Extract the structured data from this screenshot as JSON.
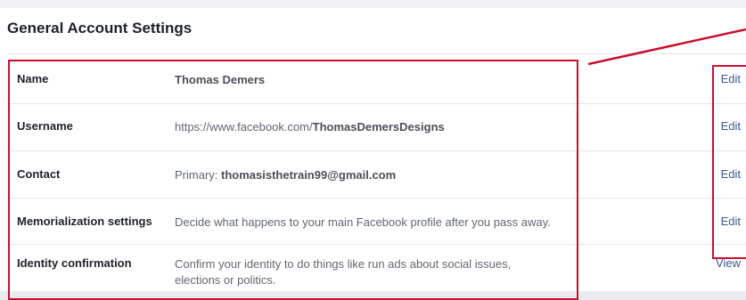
{
  "page": {
    "title": "General Account Settings"
  },
  "rows": [
    {
      "label": "Name",
      "value_plain": "",
      "value_bold": "Thomas Demers",
      "action": "Edit"
    },
    {
      "label": "Username",
      "value_plain": "https://www.facebook.com/",
      "value_bold": "ThomasDemersDesigns",
      "action": "Edit"
    },
    {
      "label": "Contact",
      "value_plain": "Primary: ",
      "value_bold": "thomasisthetrain99@gmail.com",
      "action": "Edit"
    },
    {
      "label": "Memorialization settings",
      "value_plain": "Decide what happens to your main Facebook profile after you pass away.",
      "value_bold": "",
      "action": "Edit"
    },
    {
      "label": "Identity confirmation",
      "value_plain": "Confirm your identity to do things like run ads about social issues, elections or politics.",
      "value_bold": "",
      "action": "View"
    }
  ],
  "colors": {
    "link": "#365899",
    "annotation": "#c8102e",
    "label": "#1d2129",
    "muted": "#606770"
  }
}
